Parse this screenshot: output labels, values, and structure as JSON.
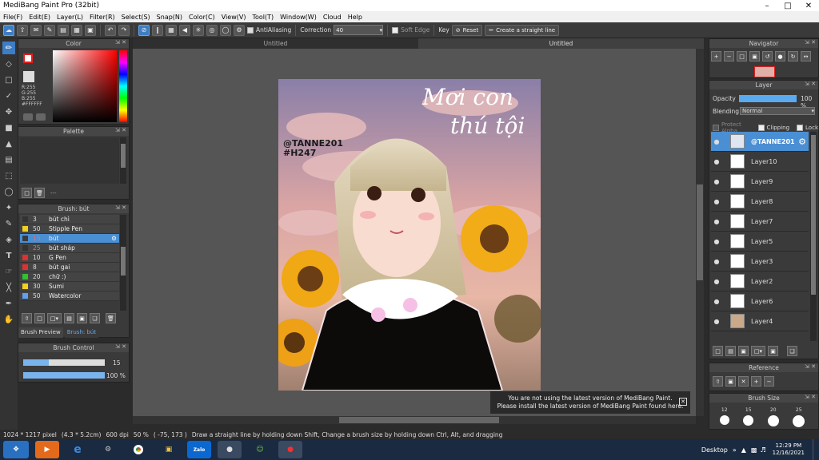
{
  "app": {
    "title": "MediBang Paint Pro (32bit)"
  },
  "menu": [
    "File(F)",
    "Edit(E)",
    "Layer(L)",
    "Filter(R)",
    "Select(S)",
    "Snap(N)",
    "Color(C)",
    "View(V)",
    "Tool(T)",
    "Window(W)",
    "Cloud",
    "Help"
  ],
  "toolbar": {
    "antialiasing": "AntiAliasing",
    "correction_label": "Correction",
    "correction_value": "40",
    "soft_edge": "Soft Edge",
    "key_label": "Key",
    "reset_label": "Reset",
    "straight_line_label": "Create a straight line"
  },
  "tabs": [
    "Untitled",
    "Untitled"
  ],
  "color_panel": {
    "title": "Color",
    "r": "R:255",
    "g": "G:255",
    "b": "B:255",
    "hex": "#FFFFFF"
  },
  "palette_panel": {
    "title": "Palette",
    "dash": "---"
  },
  "brush_panel": {
    "title": "Brush: bút",
    "items": [
      {
        "size": "3",
        "name": "bút chì",
        "color": "#333333"
      },
      {
        "size": "50",
        "name": "Stipple Pen",
        "color": "#f0d020"
      },
      {
        "size": "15",
        "name": "bút",
        "color": "#3a3a3a"
      },
      {
        "size": "25",
        "name": "bút sháp",
        "color": "#333333"
      },
      {
        "size": "10",
        "name": "G Pen",
        "color": "#e03030"
      },
      {
        "size": "8",
        "name": "bút gai",
        "color": "#e03030"
      },
      {
        "size": "20",
        "name": "chữ :)",
        "color": "#30c030"
      },
      {
        "size": "30",
        "name": "Sumi",
        "color": "#f0d020"
      },
      {
        "size": "50",
        "name": "Watercolor",
        "color": "#60a0f0"
      }
    ],
    "tab_preview": "Brush Preview",
    "tab_brush": "Brush: bút"
  },
  "brush_control": {
    "title": "Brush Control",
    "size": "15",
    "opacity": "100 %",
    "size_fraction": 0.31,
    "opacity_fraction": 1.0
  },
  "navigator": {
    "title": "Navigator"
  },
  "layer_panel": {
    "title": "Layer",
    "opacity_label": "Opacity",
    "opacity_value": "100 %",
    "blending_label": "Blending",
    "blending_value": "Normal",
    "protect_alpha": "Protect Alpha",
    "clipping": "Clipping",
    "lock": "Lock",
    "layers": [
      "@TANNE201",
      "Layer10",
      "Layer9",
      "Layer8",
      "Layer7",
      "Layer5",
      "Layer3",
      "Layer2",
      "Layer6",
      "Layer4"
    ]
  },
  "reference_panel": {
    "title": "Reference"
  },
  "brush_size_panel": {
    "title": "Brush Size",
    "sizes": [
      "12",
      "15",
      "20",
      "25"
    ]
  },
  "artwork": {
    "text_title_line1": "Mơi con",
    "text_title_line2": "thú tội",
    "handle": "@TANNE201",
    "tag": "#H247"
  },
  "notification": {
    "line1": "You are not using the latest version of MediBang Paint.",
    "line2": "Please install the latest version of MediBang Paint found here."
  },
  "status": {
    "size": "1024 * 1217 pixel",
    "cm": "(4.3 * 5.2cm)",
    "dpi": "600 dpi",
    "zoom": "50 %",
    "coords": "( -75, 173 )",
    "hint": "Draw a straight line by holding down Shift, Change a brush size by holding down Ctrl, Alt, and dragging"
  },
  "taskbar": {
    "desktop": "Desktop",
    "time": "12:29 PM",
    "date": "12/16/2021",
    "zalo": "Zalo"
  },
  "colors": {
    "accent": "#4a8fd4",
    "panel": "#3a3a3a"
  }
}
